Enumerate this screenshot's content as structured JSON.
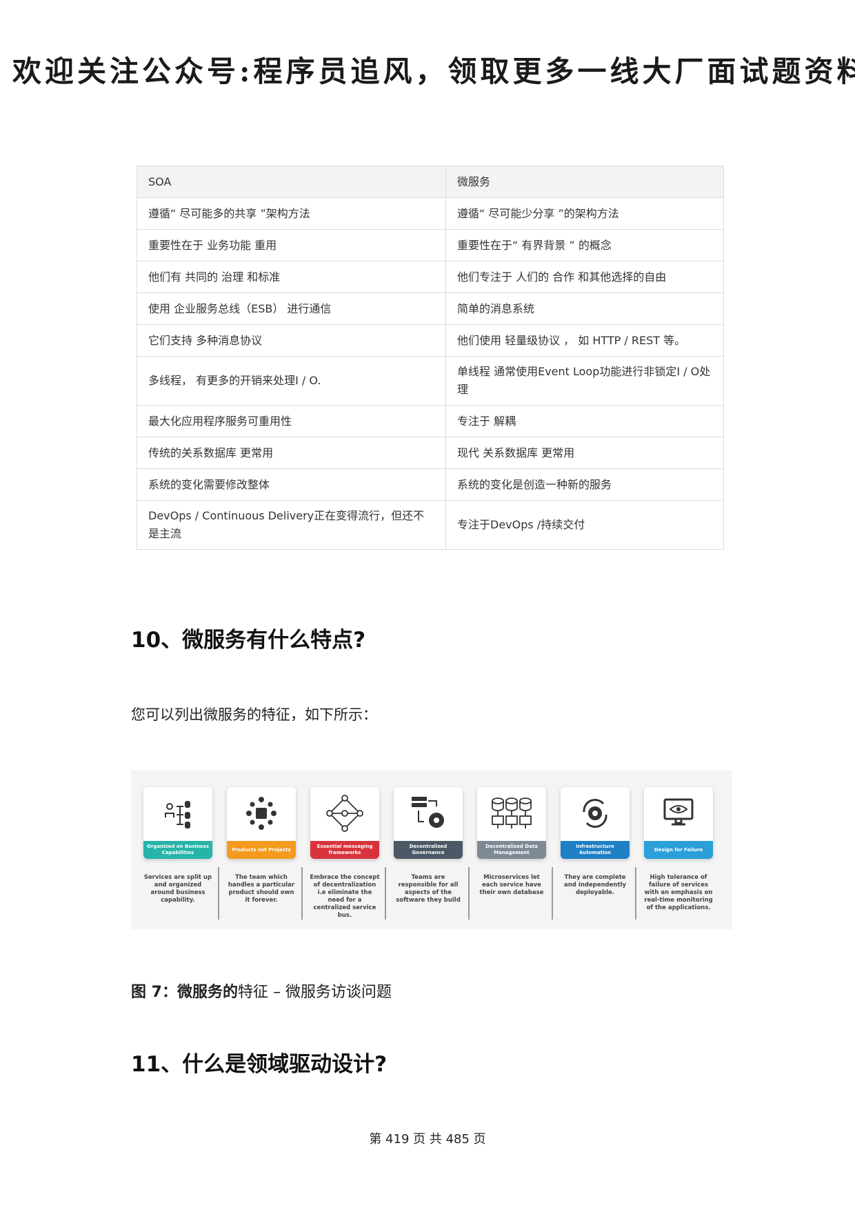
{
  "banner": "欢迎关注公众号:程序员追风，领取更多一线大厂面试题资料",
  "table": {
    "headers": [
      "SOA",
      "微服务"
    ],
    "rows": [
      [
        "遵循“ 尽可能多的共享 ”架构方法",
        "遵循“ 尽可能少分享 ”的架构方法"
      ],
      [
        "重要性在于 业务功能 重用",
        "重要性在于“ 有界背景 ” 的概念"
      ],
      [
        "他们有 共同的 治理 和标准",
        "他们专注于 人们的 合作 和其他选择的自由"
      ],
      [
        "使用 企业服务总线（ESB） 进行通信",
        "简单的消息系统"
      ],
      [
        "它们支持 多种消息协议",
        "他们使用 轻量级协议 ， 如 HTTP / REST 等。"
      ],
      [
        "多线程， 有更多的开销来处理I / O.",
        "单线程 通常使用Event Loop功能进行非锁定I / O处理"
      ],
      [
        "最大化应用程序服务可重用性",
        "专注于 解耦"
      ],
      [
        "传统的关系数据库 更常用",
        "现代 关系数据库 更常用"
      ],
      [
        "系统的变化需要修改整体",
        "系统的变化是创造一种新的服务"
      ],
      [
        "DevOps / Continuous Delivery正在变得流行，但还不是主流",
        "专注于DevOps /持续交付"
      ]
    ]
  },
  "q10": {
    "title": "10、微服务有什么特点?",
    "intro": "您可以列出微服务的特征，如下所示："
  },
  "figure": {
    "cards": [
      {
        "label": "Organized on Business Capabilities",
        "desc": "Services are split up and organized around business capability.",
        "color": "#26b3a8",
        "icon": "business-capabilities-icon"
      },
      {
        "label": "Products not Projects",
        "desc": "The team which handles a particular product should own it forever.",
        "color": "#f39a1f",
        "icon": "products-icon"
      },
      {
        "label": "Essential messaging frameworks",
        "desc": "Embrace the concept of decentralization i.e eliminate the need for a centralized service bus.",
        "color": "#d8333c",
        "icon": "messaging-network-icon"
      },
      {
        "label": "Decentralized Governance",
        "desc": "Teams are responsible for all aspects of the software they build",
        "color": "#4b5866",
        "icon": "governance-gear-icon"
      },
      {
        "label": "Decentralized Data Management",
        "desc": "Microservices let each service have their own database",
        "color": "#7d8a96",
        "icon": "database-icon"
      },
      {
        "label": "Infrastructure Automation",
        "desc": "They are complete and independently deployable.",
        "color": "#1f7fc4",
        "icon": "automation-gear-icon"
      },
      {
        "label": "Design for Failure",
        "desc": "High tolerance of failure of services with an emphasis on real-time monitoring of the applications.",
        "color": "#2a9fd8",
        "icon": "monitor-eye-icon"
      }
    ]
  },
  "caption": {
    "bold": "图 7：微服务的",
    "rest": "特征 – 微服务访谈问题"
  },
  "q11": {
    "title": "11、什么是领域驱动设计?"
  },
  "footer": "第 419 页 共 485 页"
}
